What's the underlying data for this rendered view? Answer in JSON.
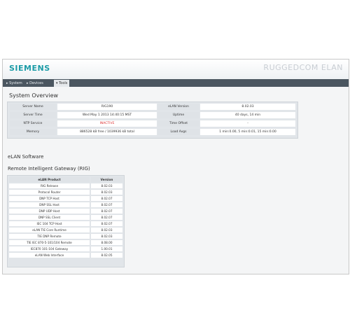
{
  "header": {
    "logo": "SIEMENS",
    "brand": "RUGGEDCOM ELAN"
  },
  "nav": {
    "tabs": [
      {
        "label": "▸ System"
      },
      {
        "label": "▸ Devices"
      },
      {
        "label": "▾ Tools"
      }
    ]
  },
  "system_overview": {
    "title": "System Overview",
    "rows": [
      {
        "label1": "Server Name",
        "value1": "RIG190",
        "label2": "eLAN Version",
        "value2": "8.02.03"
      },
      {
        "label1": "Server Time",
        "value1": "Wed May 1 2013 14:40:15 MST",
        "label2": "Uptime",
        "value2": "40 days, 14 min"
      },
      {
        "label1": "NTP Service",
        "value1": "INACTIVE",
        "label2": "Time Offset",
        "value2": "-"
      },
      {
        "label1": "Memory",
        "value1": "886528 kB free / 1039936 kB total",
        "label2": "Load Avgs",
        "value2": "1 min:0.00, 5 min:0.01, 15 min:0.00"
      }
    ]
  },
  "elan_software": {
    "title": "eLAN Software",
    "subtitle": "Remote Intelligent Gateway (RIG)",
    "headers": {
      "product": "eLAN Product",
      "version": "Version"
    },
    "rows": [
      {
        "product": "RIG Release",
        "version": "8.02.03"
      },
      {
        "product": "Protocol Router",
        "version": "8.02.03"
      },
      {
        "product": "DNP TCP Host",
        "version": "8.02.07"
      },
      {
        "product": "DNP SSL Host",
        "version": "8.02.07"
      },
      {
        "product": "DNP UDP Host",
        "version": "8.02.07"
      },
      {
        "product": "DNP SSL Client",
        "version": "8.02.07"
      },
      {
        "product": "IEC 104 TCP Host",
        "version": "8.02.07"
      },
      {
        "product": "eLAN TIE Core Runtime",
        "version": "8.02.03"
      },
      {
        "product": "TIE DNP Remote",
        "version": "8.02.03"
      },
      {
        "product": "TIE IEC 870-5-101/104 Remote",
        "version": "8.08.00"
      },
      {
        "product": "IEC870 101-104 Gateway",
        "version": "1.00.01"
      },
      {
        "product": "eLAN Web Interface",
        "version": "8.02.05"
      }
    ]
  }
}
